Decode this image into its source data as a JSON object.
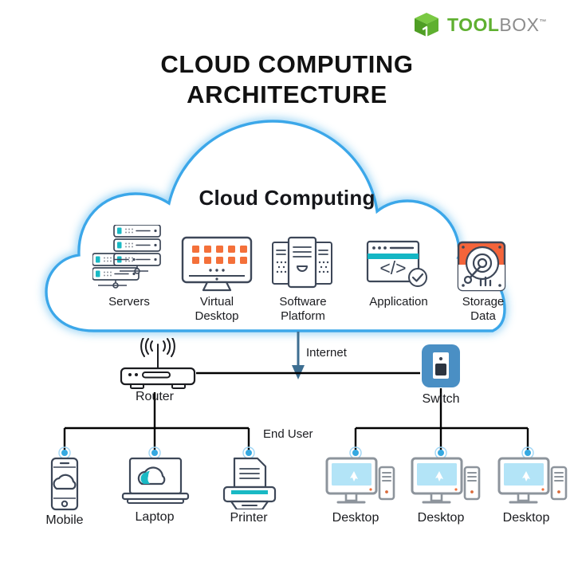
{
  "brand": {
    "name_part1": "TOOL",
    "name_part2": "BOX",
    "trademark": "™",
    "logo_icon": "green-cube-logo",
    "color_green": "#5fb030",
    "color_grey": "#8d8d8d"
  },
  "header": {
    "title_line1": "CLOUD COMPUTING",
    "title_line2": "ARCHITECTURE"
  },
  "cloud": {
    "title": "Cloud Computing",
    "stroke_color": "#3ba7e9",
    "glow_color": "#cfe9fb",
    "items": [
      {
        "label": "Servers",
        "icon": "servers-icon",
        "accent": "#2bbfc4"
      },
      {
        "label": "Virtual\nDesktop",
        "icon": "virtual-desktop-icon",
        "accent": "#f4703a"
      },
      {
        "label": "Software\nPlatform",
        "icon": "software-platform-icon",
        "accent": "#3d4758"
      },
      {
        "label": "Application",
        "icon": "application-icon",
        "accent": "#14b6c4"
      },
      {
        "label": "Storage\nData",
        "icon": "storage-data-icon",
        "accent": "#f4643a"
      }
    ]
  },
  "network": {
    "internet_label": "Internet",
    "internet_arrow_color": "#3d6e91",
    "router": {
      "label": "Router",
      "icon": "router-icon"
    },
    "switch": {
      "label": "Switch",
      "icon": "switch-icon",
      "color": "#4a8fc4"
    },
    "end_user_label": "End User",
    "line_color": "#000000"
  },
  "end_user_devices": [
    {
      "label": "Mobile",
      "icon": "mobile-icon"
    },
    {
      "label": "Laptop",
      "icon": "laptop-icon"
    },
    {
      "label": "Printer",
      "icon": "printer-icon"
    },
    {
      "label": "Desktop",
      "icon": "desktop-icon"
    },
    {
      "label": "Desktop",
      "icon": "desktop-icon"
    },
    {
      "label": "Desktop",
      "icon": "desktop-icon"
    }
  ],
  "colors": {
    "ink": "#3d4758",
    "teal": "#19b9c4",
    "orange": "#f4703a",
    "screen_blue": "#b3e4f7",
    "node_dot": "#35a8e0",
    "grey": "#8d949c"
  }
}
